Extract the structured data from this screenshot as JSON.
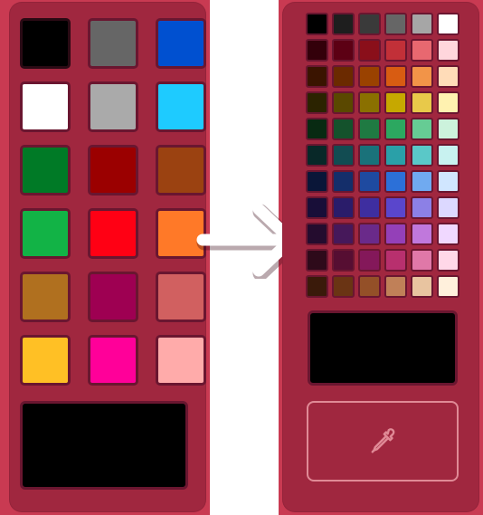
{
  "colors": {
    "background": "#c93a52",
    "panel": "#a0273f",
    "swatch_border": "#6a1630",
    "selected_border": "#2a0a14",
    "button_border": "#e08a96"
  },
  "basic_palette": [
    {
      "color": "#000000",
      "name": "black"
    },
    {
      "color": "#666666",
      "name": "gray"
    },
    {
      "color": "#0050d0",
      "name": "blue"
    },
    {
      "color": "#ffffff",
      "name": "white"
    },
    {
      "color": "#aaaaaa",
      "name": "light-gray"
    },
    {
      "color": "#1ecbff",
      "name": "sky-blue"
    },
    {
      "color": "#007a26",
      "name": "dark-green"
    },
    {
      "color": "#9b0000",
      "name": "dark-red"
    },
    {
      "color": "#9b4211",
      "name": "brown"
    },
    {
      "color": "#12b346",
      "name": "green"
    },
    {
      "color": "#ff0014",
      "name": "red"
    },
    {
      "color": "#ff7928",
      "name": "orange"
    },
    {
      "color": "#b0701f",
      "name": "ochre"
    },
    {
      "color": "#9e0052",
      "name": "magenta-dark"
    },
    {
      "color": "#d16060",
      "name": "salmon"
    },
    {
      "color": "#ffc025",
      "name": "yellow"
    },
    {
      "color": "#ff0099",
      "name": "pink"
    },
    {
      "color": "#ffabaa",
      "name": "light-pink"
    }
  ],
  "selected_color": "#000000",
  "extended_palette": [
    [
      "#000000",
      "#1e1e1e",
      "#3a3a3a",
      "#666666",
      "#a6a6a6",
      "#ffffff"
    ],
    [
      "#33000a",
      "#5c0014",
      "#8a0f1a",
      "#c23038",
      "#e86870",
      "#ffd6dc"
    ],
    [
      "#3a1400",
      "#6b2a00",
      "#9a4200",
      "#d85c12",
      "#f29448",
      "#ffdcb8"
    ],
    [
      "#2b2300",
      "#5a4800",
      "#8a7000",
      "#c6a800",
      "#e8c94a",
      "#fff2b0"
    ],
    [
      "#082a12",
      "#14522c",
      "#1f7a42",
      "#2ca860",
      "#66cc94",
      "#ccf2dc"
    ],
    [
      "#082828",
      "#124c52",
      "#1a727a",
      "#2aa0a8",
      "#5ac8c8",
      "#c8f2f0"
    ],
    [
      "#0a1638",
      "#142e6a",
      "#1e4aa0",
      "#2c70d8",
      "#70aaf0",
      "#d0e6ff"
    ],
    [
      "#180e38",
      "#2a1c6a",
      "#3e2ea0",
      "#5a46cc",
      "#8c80e6",
      "#dcd8ff"
    ],
    [
      "#240c2e",
      "#46185a",
      "#6a2a8a",
      "#9440b8",
      "#c078dc",
      "#f0d8ff"
    ],
    [
      "#2e0a1a",
      "#560e32",
      "#84185a",
      "#b8306e",
      "#e078a8",
      "#ffd8e8"
    ],
    [
      "#3a1a0a",
      "#6a3414",
      "#945028",
      "#c08058",
      "#e8c4a0",
      "#fff0dc"
    ]
  ],
  "eyedropper": {
    "icon": "eyedropper-icon"
  },
  "arrow": {
    "icon": "arrow-right-icon",
    "color": "#ffffff"
  }
}
